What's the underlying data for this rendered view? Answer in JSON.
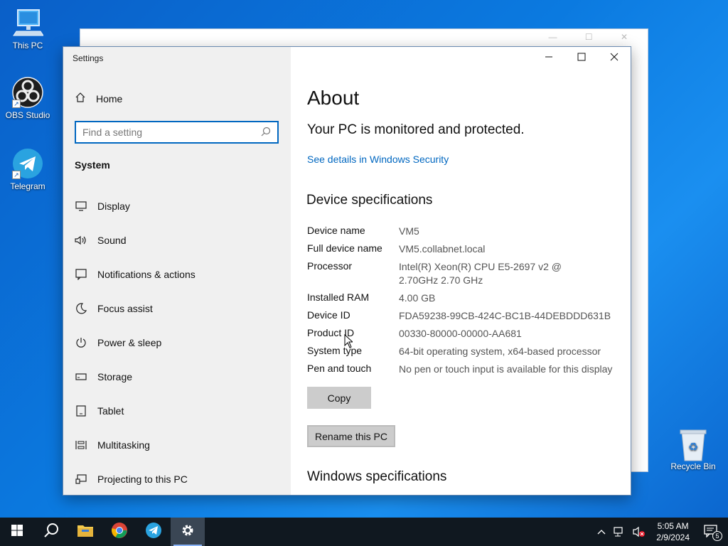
{
  "desktop": {
    "icons": [
      {
        "label": "This PC"
      },
      {
        "label": "OBS Studio"
      },
      {
        "label": "Telegram"
      },
      {
        "label": "Recycle Bin"
      }
    ]
  },
  "window": {
    "title": "Settings",
    "sidebar": {
      "home": "Home",
      "search_placeholder": "Find a setting",
      "section": "System",
      "items": [
        {
          "label": "Display",
          "icon": "monitor-icon"
        },
        {
          "label": "Sound",
          "icon": "speaker-icon"
        },
        {
          "label": "Notifications & actions",
          "icon": "notification-icon"
        },
        {
          "label": "Focus assist",
          "icon": "moon-icon"
        },
        {
          "label": "Power & sleep",
          "icon": "power-icon"
        },
        {
          "label": "Storage",
          "icon": "storage-icon"
        },
        {
          "label": "Tablet",
          "icon": "tablet-icon"
        },
        {
          "label": "Multitasking",
          "icon": "multitasking-icon"
        },
        {
          "label": "Projecting to this PC",
          "icon": "projector-icon"
        }
      ]
    },
    "content": {
      "title": "About",
      "protection": "Your PC is monitored and protected.",
      "security_link": "See details in Windows Security",
      "device_specs_heading": "Device specifications",
      "specs": [
        {
          "key": "Device name",
          "value": "VM5"
        },
        {
          "key": "Full device name",
          "value": "VM5.collabnet.local"
        },
        {
          "key": "Processor",
          "value": "Intel(R) Xeon(R) CPU E5-2697 v2 @ 2.70GHz   2.70 GHz"
        },
        {
          "key": "Installed RAM",
          "value": "4.00 GB"
        },
        {
          "key": "Device ID",
          "value": "FDA59238-99CB-424C-BC1B-44DEBDDD631B"
        },
        {
          "key": "Product ID",
          "value": "00330-80000-00000-AA681"
        },
        {
          "key": "System type",
          "value": "64-bit operating system, x64-based processor"
        },
        {
          "key": "Pen and touch",
          "value": "No pen or touch input is available for this display"
        }
      ],
      "copy_button": "Copy",
      "rename_button": "Rename this PC",
      "windows_specs_heading": "Windows specifications"
    }
  },
  "taskbar": {
    "time": "5:05 AM",
    "date": "2/9/2024",
    "notification_count": "5"
  }
}
